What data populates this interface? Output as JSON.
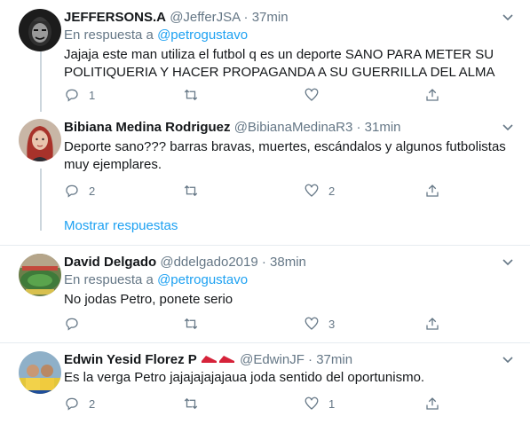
{
  "tweets": [
    {
      "name": "JEFFERSONS.A",
      "handle": "@JefferJSA",
      "dot": "·",
      "time": "37min",
      "reply_prefix": "En respuesta a",
      "reply_to": "@petrogustavo",
      "text": "Jajaja este man utiliza el futbol q es un deporte SANO PARA METER SU POLITIQUERIA Y HACER PROPAGANDA A SU GUERRILLA DEL ALMA",
      "replies": "1",
      "retweets": "",
      "likes": "",
      "avatar_icon": "masked-face"
    },
    {
      "name": "Bibiana Medina Rodriguez",
      "handle": "@BibianaMedinaR3",
      "dot": "·",
      "time": "31min",
      "text": "Deporte sano??? barras bravas, muertes, escándalos y algunos futbolistas muy ejemplares.",
      "replies": "2",
      "retweets": "",
      "likes": "2",
      "avatar_icon": "red-hair-woman"
    },
    {
      "name": "David Delgado",
      "handle": "@ddelgado2019",
      "dot": "·",
      "time": "38min",
      "reply_prefix": "En respuesta a",
      "reply_to": "@petrogustavo",
      "text": "No jodas Petro, ponete serio",
      "replies": "",
      "retweets": "",
      "likes": "3",
      "avatar_icon": "stadium"
    },
    {
      "name": "Edwin Yesid Florez P",
      "handle": "@EdwinJF",
      "dot": "·",
      "time": "37min",
      "text": "Es la verga Petro jajajajajajaua joda sentido del oportunismo.",
      "replies": "2",
      "retweets": "",
      "likes": "1",
      "avatar_icon": "fans-photo",
      "name_emoji": "red-sneakers"
    }
  ],
  "show_replies_label": "Mostrar respuestas",
  "colors": {
    "link": "#1da1f2",
    "muted": "#657786",
    "thread_line": "#ccd6dd",
    "divider": "#e6ecf0"
  }
}
